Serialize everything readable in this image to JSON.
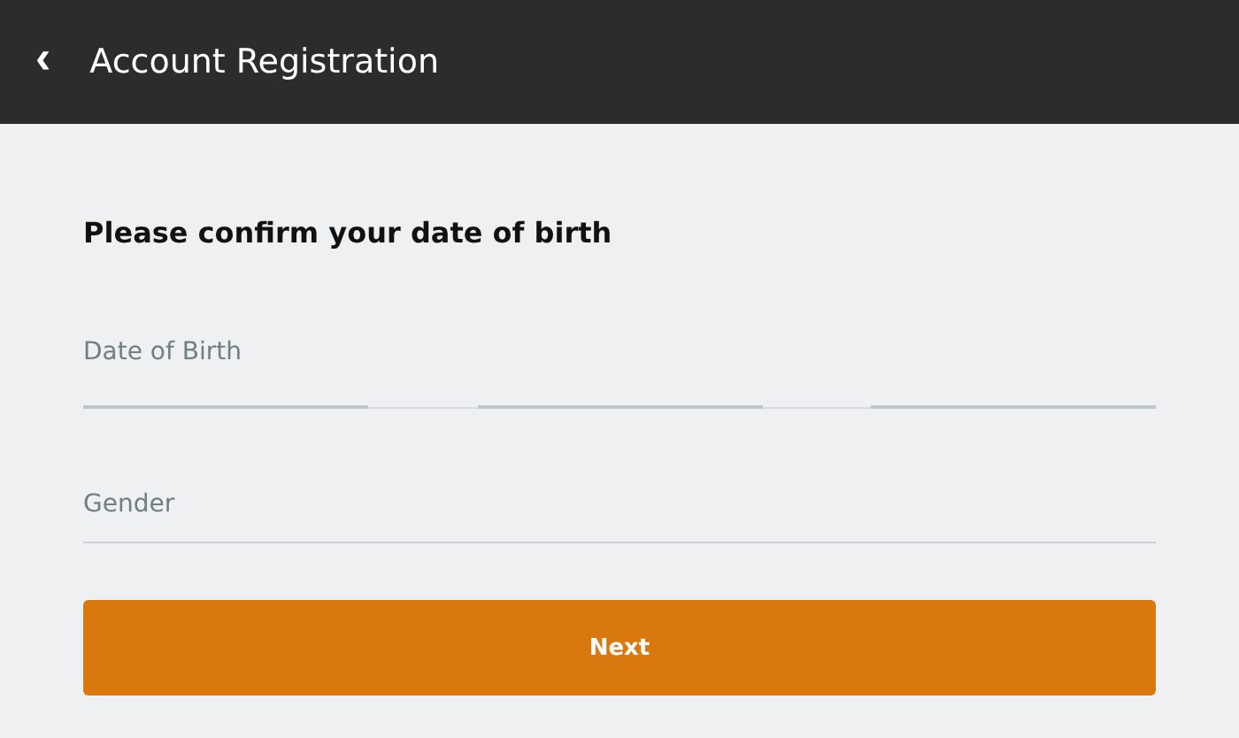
{
  "header": {
    "back": "‹",
    "title": "Account Registration"
  },
  "heading": "Please confirm your date of birth",
  "date_of_birth": {
    "label": "Date of Birth"
  },
  "gender": {
    "label": "Gender"
  },
  "button": "Next"
}
